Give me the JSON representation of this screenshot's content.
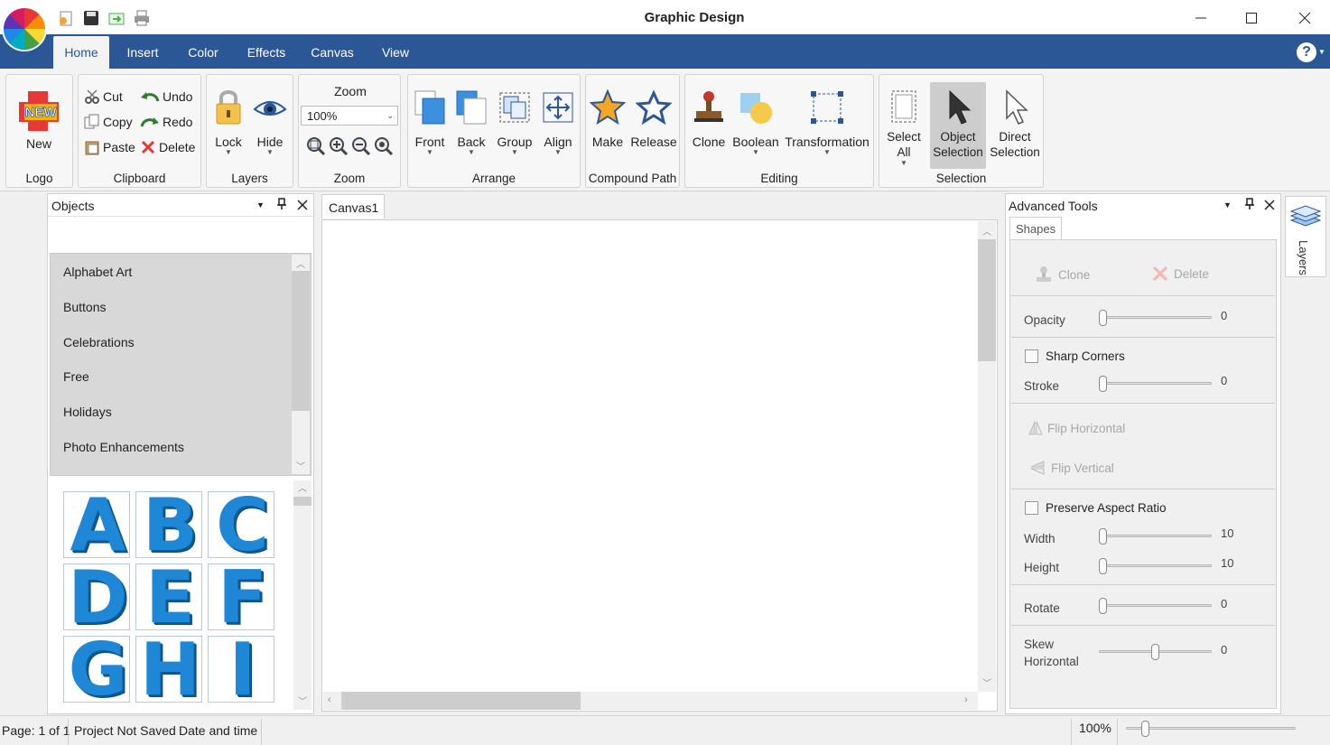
{
  "window": {
    "title": "Graphic Design"
  },
  "menu": {
    "tabs": [
      {
        "label": "Home",
        "active": true
      },
      {
        "label": "Insert"
      },
      {
        "label": "Color"
      },
      {
        "label": "Effects"
      },
      {
        "label": "Canvas"
      },
      {
        "label": "View"
      }
    ]
  },
  "ribbon": {
    "logo": {
      "new_label": "New",
      "group": "Logo"
    },
    "clipboard": {
      "cut": "Cut",
      "copy": "Copy",
      "paste": "Paste",
      "undo": "Undo",
      "redo": "Redo",
      "delete": "Delete",
      "group": "Clipboard"
    },
    "layers": {
      "lock": "Lock",
      "hide": "Hide",
      "group": "Layers"
    },
    "zoom": {
      "title": "Zoom",
      "value": "100%",
      "group": "Zoom"
    },
    "arrange": {
      "front": "Front",
      "back": "Back",
      "group_btn": "Group",
      "align": "Align",
      "group": "Arrange"
    },
    "compound": {
      "make": "Make",
      "release": "Release",
      "group": "Compound Path"
    },
    "editing": {
      "clone": "Clone",
      "boolean": "Boolean",
      "transformation": "Transformation",
      "group": "Editing"
    },
    "selection": {
      "select_all_1": "Select",
      "select_all_2": "All",
      "object_sel_1": "Object",
      "object_sel_2": "Selection",
      "direct_sel_1": "Direct",
      "direct_sel_2": "Selection",
      "group": "Selection"
    }
  },
  "objects_panel": {
    "title": "Objects",
    "categories": [
      "Alphabet Art",
      "Buttons",
      "Celebrations",
      "Free",
      "Holidays",
      "Photo Enhancements"
    ],
    "tiles": [
      "A",
      "B",
      "C",
      "D",
      "E",
      "F",
      "G",
      "H",
      "I"
    ]
  },
  "canvas": {
    "tab": "Canvas1"
  },
  "advanced_tools": {
    "title": "Advanced Tools",
    "tab": "Shapes",
    "clone": "Clone",
    "delete": "Delete",
    "opacity": {
      "label": "Opacity",
      "value": "0"
    },
    "sharp_corners": "Sharp Corners",
    "stroke": {
      "label": "Stroke",
      "value": "0"
    },
    "flip_horizontal": "Flip Horizontal",
    "flip_vertical": "Flip Vertical",
    "preserve_aspect": "Preserve Aspect Ratio",
    "width": {
      "label": "Width",
      "value": "10"
    },
    "height": {
      "label": "Height",
      "value": "10"
    },
    "rotate": {
      "label": "Rotate",
      "value": "0"
    },
    "skew": {
      "label_1": "Skew",
      "label_2": "Horizontal",
      "value": "0"
    }
  },
  "layers_tab": {
    "label": "Layers"
  },
  "status": {
    "page": "Page: 1 of 1",
    "saved": "Project Not Saved",
    "datetime": "Date and time",
    "zoom": "100%"
  }
}
